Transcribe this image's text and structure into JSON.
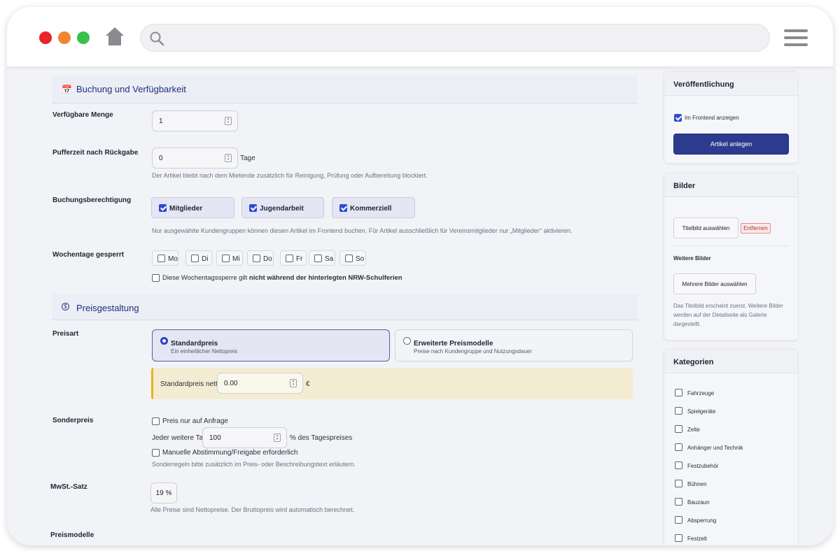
{
  "browser": {
    "url_value": "",
    "colors": {
      "close": "#e7252b",
      "minimize": "#f1852f",
      "maximize": "#37c24a"
    },
    "icons": [
      "home-icon",
      "search-icon",
      "menu-icon"
    ]
  },
  "booking": {
    "title": "Buchung und Verfügbarkeit",
    "icon": "calendar-icon",
    "quantity": {
      "label": "Verfügbare Menge",
      "value": "1"
    },
    "buffer": {
      "label": "Pufferzeit nach Rückgabe",
      "value": "0",
      "unit": "Tage",
      "help": "Der Artikel bleibt nach dem Mietende zusätzlich für Reinigung, Prüfung oder Aufbereitung blockiert."
    },
    "permission": {
      "label": "Buchungsberechtigung",
      "options": [
        {
          "label": "Mitglieder",
          "checked": true
        },
        {
          "label": "Jugendarbeit",
          "checked": true
        },
        {
          "label": "Kommerziell",
          "checked": true
        }
      ],
      "help": "Nur ausgewählte Kundengruppen können diesen Artikel im Frontend buchen. Für Artikel ausschließlich für Vereinsmitglieder nur „Mitglieder\" aktivieren."
    },
    "weekdays": {
      "label": "Wochentage gesperrt",
      "days": [
        "Mo",
        "Di",
        "Mi",
        "Do",
        "Fr",
        "Sa",
        "So"
      ],
      "holiday_prefix": "Diese Wochentagssperre gilt ",
      "holiday_bold": "nicht während der hinterlegten NRW-Schulferien"
    }
  },
  "pricing": {
    "title": "Preisgestaltung",
    "icon": "dollar-icon",
    "price_type_label": "Preisart",
    "standard": {
      "title": "Standardpreis",
      "sub": "Ein einheitlicher Nettopreis",
      "selected": true
    },
    "extended": {
      "title": "Erweiterte Preismodelle",
      "sub": "Preise nach Kundengruppe und Nutzungsdauer",
      "selected": false
    },
    "net_price": {
      "label": "Standardpreis netto",
      "value": "0.00",
      "currency": "€"
    },
    "special": {
      "label": "Sonderpreis",
      "on_request": "Preis nur auf Anfrage",
      "per_day_prefix": "Jeder weitere Tag",
      "per_day_value": "100",
      "per_day_suffix": "% des Tagespreises",
      "manual": "Manuelle Abstimmung/Freigabe erforderlich",
      "help": "Sonderregeln bitte zusätzlich im Preis- oder Beschreibungstext erläutern."
    },
    "vat": {
      "label": "MwSt.-Satz",
      "value": "19 %",
      "help": "Alle Preise sind Nettopreise. Der Bruttopreis wird automatisch berechnet."
    },
    "models_label": "Preismodelle"
  },
  "sidebar": {
    "publish": {
      "title": "Veröffentlichung",
      "show_frontend": "Im Frontend anzeigen",
      "show_checked": true,
      "create_button": "Artikel anlegen",
      "accent": "#2d3b8f"
    },
    "images": {
      "title": "Bilder",
      "select_title": "Titelbild auswählen",
      "remove": "Entfernen",
      "more_label": "Weitere Bilder",
      "select_more": "Mehrere Bilder auswählen",
      "help": "Das Titelbild erscheint zuerst. Weitere Bilder werden auf der Detailseite als Galerie dargestellt."
    },
    "categories": {
      "title": "Kategorien",
      "items": [
        "Fahrzeuge",
        "Spielgeräte",
        "Zelte",
        "Anhänger und Technik",
        "Festzubehör",
        "Bühnen",
        "Bauzaun",
        "Absperrung",
        "Festzelt"
      ]
    }
  }
}
